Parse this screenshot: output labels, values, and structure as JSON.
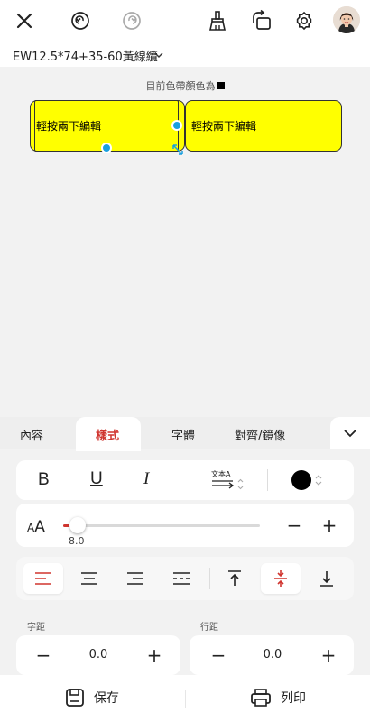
{
  "colors": {
    "accent": "#d0352f",
    "label_fill": "#ffff00",
    "handle": "#1aa0e0",
    "text_color_swatch": "#000000"
  },
  "topbar": {
    "icons": [
      "close-icon",
      "undo-icon",
      "redo-icon",
      "clear-brush-icon",
      "rotate-icon",
      "settings-icon",
      "avatar"
    ]
  },
  "label": {
    "name": "EW12.5*74+35-60黃線纜"
  },
  "canvas": {
    "color_hint": "目前色帶顏色為",
    "cells": [
      "輕按兩下編輯",
      "輕按兩下編輯"
    ]
  },
  "panel": {
    "tabs": [
      "內容",
      "樣式",
      "字體",
      "對齊/鏡像"
    ],
    "active_tab": "樣式",
    "format": {
      "bold": "B",
      "underline": "U",
      "italic": "I",
      "text_direction": "文本A"
    },
    "font_size": {
      "icon_label": "AA",
      "value": "8.0",
      "fraction": 0.02
    },
    "char_spacing": {
      "label": "字距",
      "value": "0.0",
      "minus": "−",
      "plus": "+"
    },
    "line_spacing": {
      "label": "行距",
      "value": "0.0",
      "minus": "−",
      "plus": "+"
    },
    "size_minus": "−",
    "size_plus": "+"
  },
  "bottom": {
    "save": "保存",
    "print": "列印"
  }
}
